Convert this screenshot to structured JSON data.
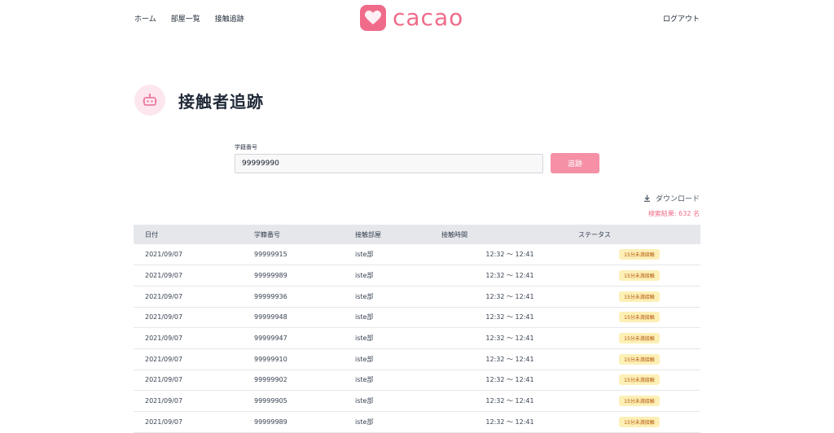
{
  "nav": {
    "links": [
      "ホーム",
      "部屋一覧",
      "接触追跡"
    ],
    "logo_text": "cacao",
    "logout": "ログアウト"
  },
  "page": {
    "title": "接触者追跡",
    "icon": "robot-icon"
  },
  "search": {
    "label": "学籍番号",
    "value": "99999990",
    "button": "追跡"
  },
  "download": {
    "label": "ダウンロード",
    "icon": "download-icon"
  },
  "result": {
    "count_text": "検索結果: 632 名"
  },
  "table": {
    "headers": [
      "日付",
      "学籍番号",
      "接触部屋",
      "接触時間",
      "ステータス"
    ],
    "rows": [
      {
        "date": "2021/09/07",
        "id": "99999915",
        "room": "iste部",
        "time": "12:32 〜 12:41",
        "status": "15分未満接触"
      },
      {
        "date": "2021/09/07",
        "id": "99999989",
        "room": "iste部",
        "time": "12:32 〜 12:41",
        "status": "15分未満接触"
      },
      {
        "date": "2021/09/07",
        "id": "99999936",
        "room": "iste部",
        "time": "12:32 〜 12:41",
        "status": "15分未満接触"
      },
      {
        "date": "2021/09/07",
        "id": "99999948",
        "room": "iste部",
        "time": "12:32 〜 12:41",
        "status": "15分未満接触"
      },
      {
        "date": "2021/09/07",
        "id": "99999947",
        "room": "iste部",
        "time": "12:32 〜 12:41",
        "status": "15分未満接触"
      },
      {
        "date": "2021/09/07",
        "id": "99999910",
        "room": "iste部",
        "time": "12:32 〜 12:41",
        "status": "15分未満接触"
      },
      {
        "date": "2021/09/07",
        "id": "99999902",
        "room": "iste部",
        "time": "12:32 〜 12:41",
        "status": "15分未満接触"
      },
      {
        "date": "2021/09/07",
        "id": "99999905",
        "room": "iste部",
        "time": "12:32 〜 12:41",
        "status": "15分未満接触"
      },
      {
        "date": "2021/09/07",
        "id": "99999989",
        "room": "iste部",
        "time": "12:32 〜 12:41",
        "status": "15分未満接触"
      }
    ]
  },
  "colors": {
    "accent": "#f06b8a",
    "button": "#f590a6",
    "badge_bg": "#fdf0b6",
    "badge_text": "#b45309"
  }
}
